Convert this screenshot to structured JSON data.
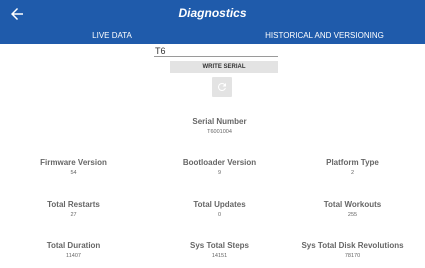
{
  "header": {
    "title": "Diagnostics",
    "tabs": [
      {
        "label": "LIVE DATA",
        "active": true
      },
      {
        "label": "HISTORICAL AND VERSIONING",
        "active": false
      }
    ]
  },
  "serial_form": {
    "input_value": "T6",
    "write_button_label": "WRITE SERIAL"
  },
  "stats": {
    "serial_number": {
      "label": "Serial Number",
      "value": "T6001004"
    },
    "firmware_version": {
      "label": "Firmware Version",
      "value": "54"
    },
    "bootloader_version": {
      "label": "Bootloader Version",
      "value": "9"
    },
    "platform_type": {
      "label": "Platform Type",
      "value": "2"
    },
    "total_restarts": {
      "label": "Total Restarts",
      "value": "27"
    },
    "total_updates": {
      "label": "Total Updates",
      "value": "0"
    },
    "total_workouts": {
      "label": "Total Workouts",
      "value": "255"
    },
    "total_duration": {
      "label": "Total Duration",
      "value": "11407"
    },
    "sys_total_steps": {
      "label": "Sys Total Steps",
      "value": "14151"
    },
    "sys_total_disk_revolutions": {
      "label": "Sys Total Disk Revolutions",
      "value": "78170"
    }
  },
  "colors": {
    "app_bar": "#1f5bab",
    "button_bg": "#e3e3e3",
    "text": "#666666"
  },
  "icons": {
    "back": "arrow-left-icon",
    "refresh": "refresh-icon"
  }
}
